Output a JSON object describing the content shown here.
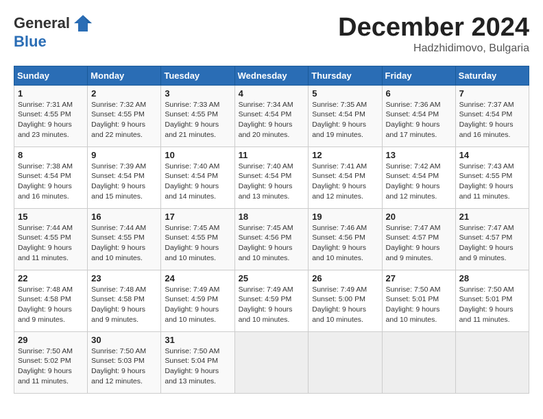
{
  "header": {
    "logo_general": "General",
    "logo_blue": "Blue",
    "month": "December 2024",
    "location": "Hadzhidimovo, Bulgaria"
  },
  "weekdays": [
    "Sunday",
    "Monday",
    "Tuesday",
    "Wednesday",
    "Thursday",
    "Friday",
    "Saturday"
  ],
  "weeks": [
    [
      {
        "day": 1,
        "sunrise": "7:31 AM",
        "sunset": "4:55 PM",
        "daylight": "9 hours and 23 minutes."
      },
      {
        "day": 2,
        "sunrise": "7:32 AM",
        "sunset": "4:55 PM",
        "daylight": "9 hours and 22 minutes."
      },
      {
        "day": 3,
        "sunrise": "7:33 AM",
        "sunset": "4:55 PM",
        "daylight": "9 hours and 21 minutes."
      },
      {
        "day": 4,
        "sunrise": "7:34 AM",
        "sunset": "4:54 PM",
        "daylight": "9 hours and 20 minutes."
      },
      {
        "day": 5,
        "sunrise": "7:35 AM",
        "sunset": "4:54 PM",
        "daylight": "9 hours and 19 minutes."
      },
      {
        "day": 6,
        "sunrise": "7:36 AM",
        "sunset": "4:54 PM",
        "daylight": "9 hours and 17 minutes."
      },
      {
        "day": 7,
        "sunrise": "7:37 AM",
        "sunset": "4:54 PM",
        "daylight": "9 hours and 16 minutes."
      }
    ],
    [
      {
        "day": 8,
        "sunrise": "7:38 AM",
        "sunset": "4:54 PM",
        "daylight": "9 hours and 16 minutes."
      },
      {
        "day": 9,
        "sunrise": "7:39 AM",
        "sunset": "4:54 PM",
        "daylight": "9 hours and 15 minutes."
      },
      {
        "day": 10,
        "sunrise": "7:40 AM",
        "sunset": "4:54 PM",
        "daylight": "9 hours and 14 minutes."
      },
      {
        "day": 11,
        "sunrise": "7:40 AM",
        "sunset": "4:54 PM",
        "daylight": "9 hours and 13 minutes."
      },
      {
        "day": 12,
        "sunrise": "7:41 AM",
        "sunset": "4:54 PM",
        "daylight": "9 hours and 12 minutes."
      },
      {
        "day": 13,
        "sunrise": "7:42 AM",
        "sunset": "4:54 PM",
        "daylight": "9 hours and 12 minutes."
      },
      {
        "day": 14,
        "sunrise": "7:43 AM",
        "sunset": "4:55 PM",
        "daylight": "9 hours and 11 minutes."
      }
    ],
    [
      {
        "day": 15,
        "sunrise": "7:44 AM",
        "sunset": "4:55 PM",
        "daylight": "9 hours and 11 minutes."
      },
      {
        "day": 16,
        "sunrise": "7:44 AM",
        "sunset": "4:55 PM",
        "daylight": "9 hours and 10 minutes."
      },
      {
        "day": 17,
        "sunrise": "7:45 AM",
        "sunset": "4:55 PM",
        "daylight": "9 hours and 10 minutes."
      },
      {
        "day": 18,
        "sunrise": "7:45 AM",
        "sunset": "4:56 PM",
        "daylight": "9 hours and 10 minutes."
      },
      {
        "day": 19,
        "sunrise": "7:46 AM",
        "sunset": "4:56 PM",
        "daylight": "9 hours and 10 minutes."
      },
      {
        "day": 20,
        "sunrise": "7:47 AM",
        "sunset": "4:57 PM",
        "daylight": "9 hours and 9 minutes."
      },
      {
        "day": 21,
        "sunrise": "7:47 AM",
        "sunset": "4:57 PM",
        "daylight": "9 hours and 9 minutes."
      }
    ],
    [
      {
        "day": 22,
        "sunrise": "7:48 AM",
        "sunset": "4:58 PM",
        "daylight": "9 hours and 9 minutes."
      },
      {
        "day": 23,
        "sunrise": "7:48 AM",
        "sunset": "4:58 PM",
        "daylight": "9 hours and 9 minutes."
      },
      {
        "day": 24,
        "sunrise": "7:49 AM",
        "sunset": "4:59 PM",
        "daylight": "9 hours and 10 minutes."
      },
      {
        "day": 25,
        "sunrise": "7:49 AM",
        "sunset": "4:59 PM",
        "daylight": "9 hours and 10 minutes."
      },
      {
        "day": 26,
        "sunrise": "7:49 AM",
        "sunset": "5:00 PM",
        "daylight": "9 hours and 10 minutes."
      },
      {
        "day": 27,
        "sunrise": "7:50 AM",
        "sunset": "5:01 PM",
        "daylight": "9 hours and 10 minutes."
      },
      {
        "day": 28,
        "sunrise": "7:50 AM",
        "sunset": "5:01 PM",
        "daylight": "9 hours and 11 minutes."
      }
    ],
    [
      {
        "day": 29,
        "sunrise": "7:50 AM",
        "sunset": "5:02 PM",
        "daylight": "9 hours and 11 minutes."
      },
      {
        "day": 30,
        "sunrise": "7:50 AM",
        "sunset": "5:03 PM",
        "daylight": "9 hours and 12 minutes."
      },
      {
        "day": 31,
        "sunrise": "7:50 AM",
        "sunset": "5:04 PM",
        "daylight": "9 hours and 13 minutes."
      },
      null,
      null,
      null,
      null
    ]
  ]
}
